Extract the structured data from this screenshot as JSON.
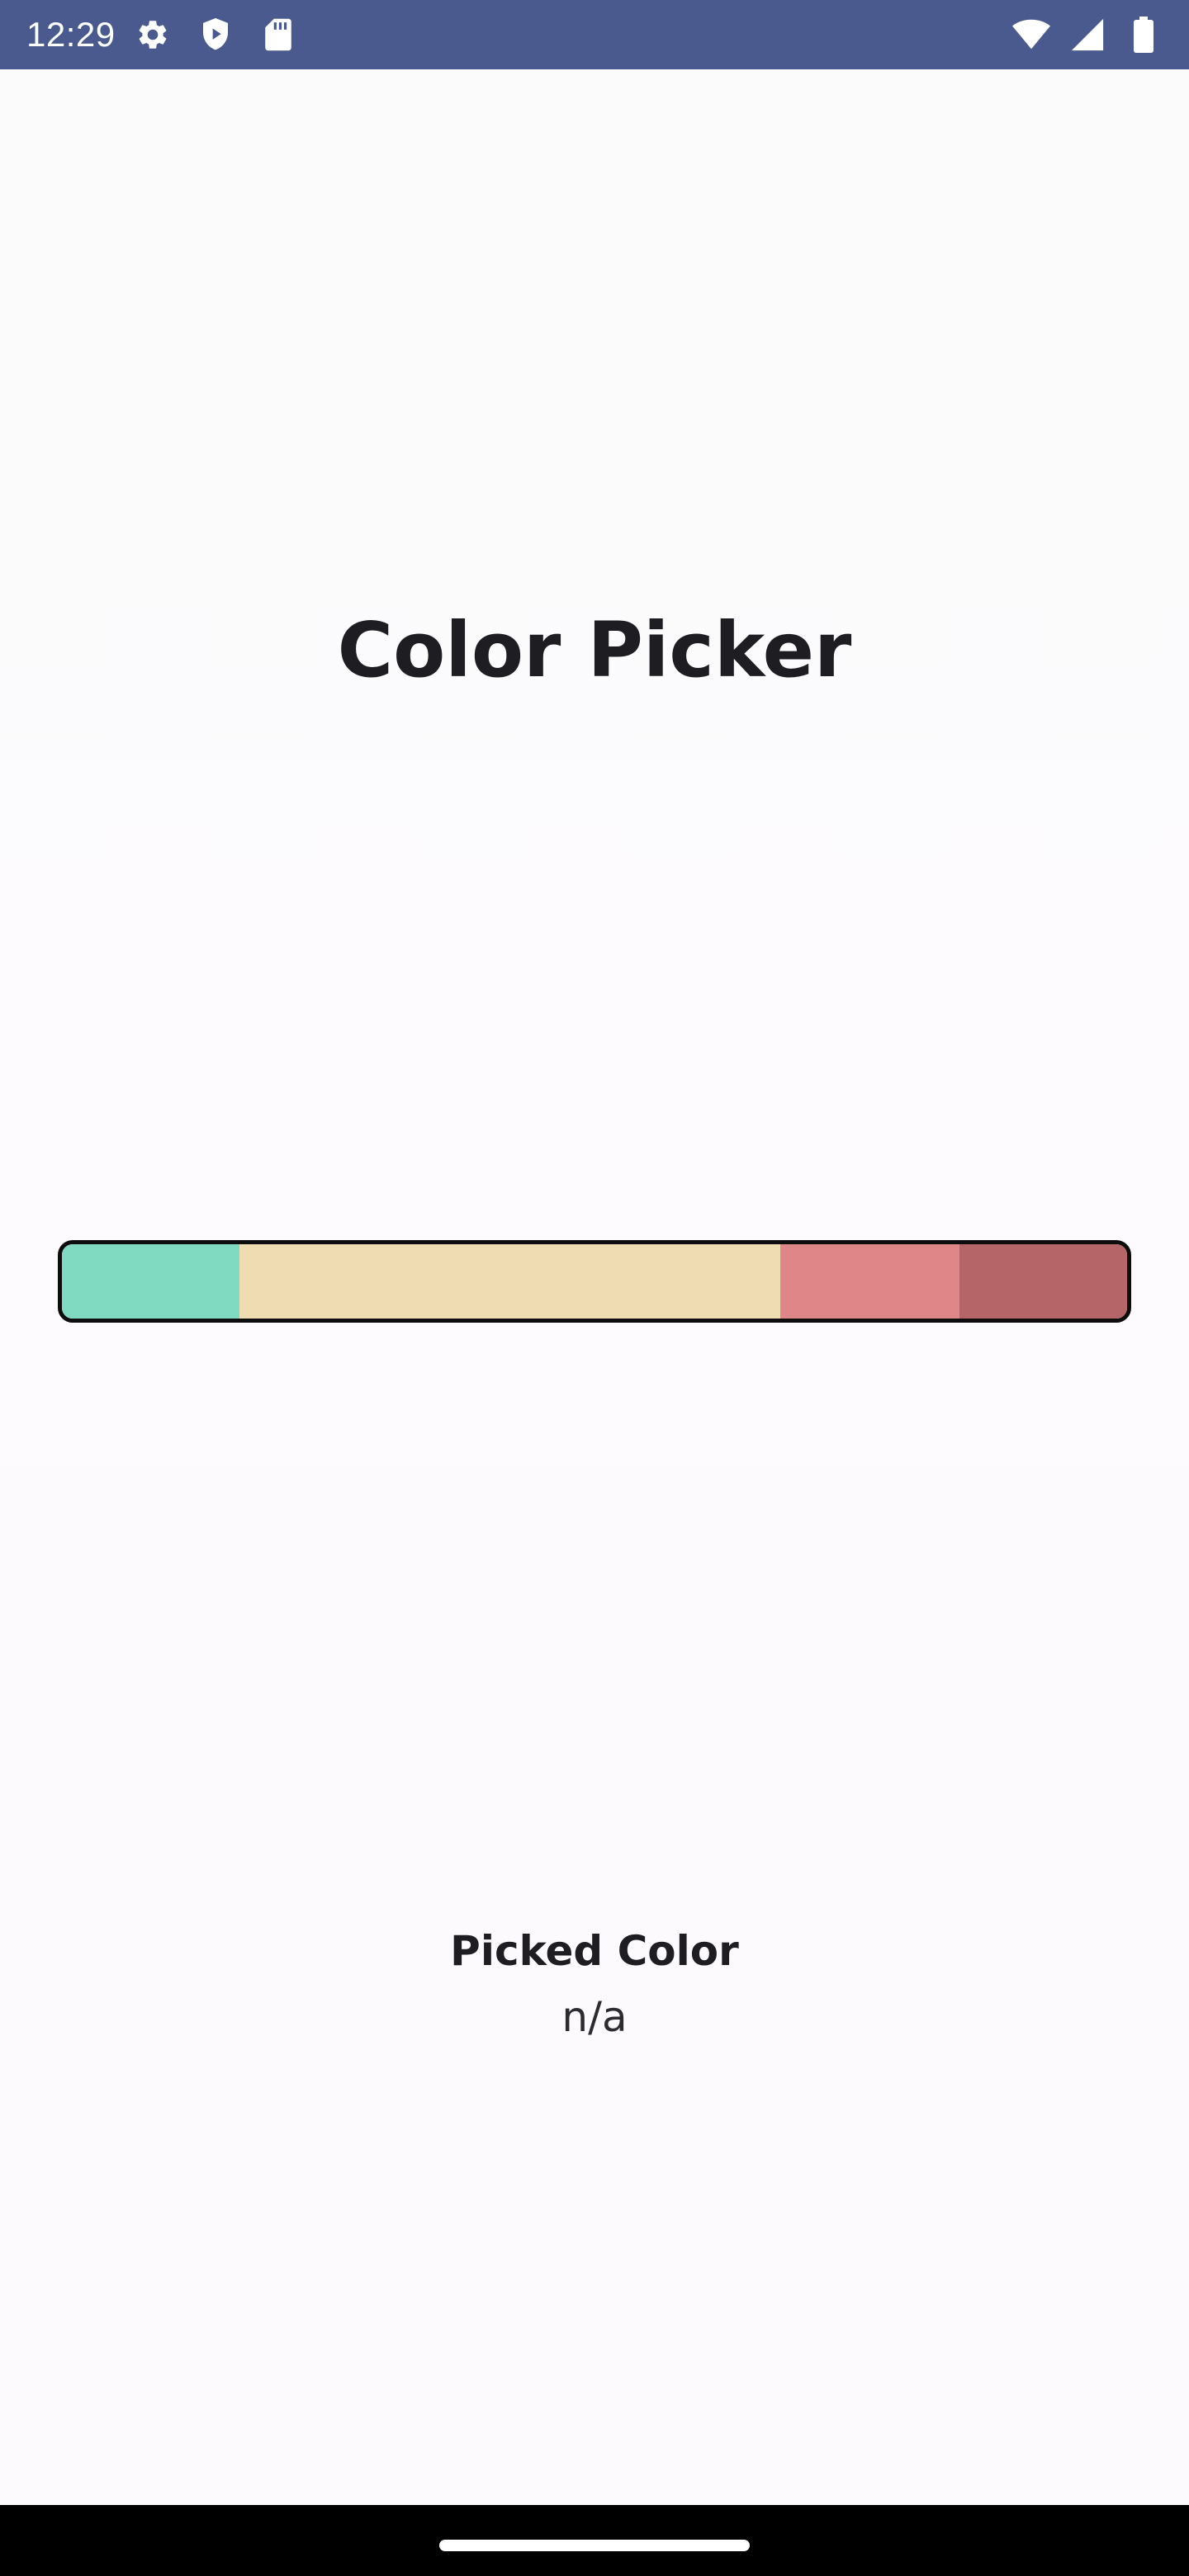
{
  "status_bar": {
    "time": "12:29",
    "left_icons": [
      "gear-icon",
      "shield-play-icon",
      "sd-card-icon"
    ],
    "right_icons": [
      "wifi-icon",
      "signal-icon",
      "battery-icon"
    ]
  },
  "main": {
    "title": "Color Picker",
    "swatches": [
      {
        "name": "teal",
        "color": "#7fdac1"
      },
      {
        "name": "sand",
        "color": "#efdcb2"
      },
      {
        "name": "rose",
        "color": "#de8688"
      },
      {
        "name": "maroon",
        "color": "#b56467"
      }
    ],
    "picked_label": "Picked Color",
    "picked_value": "n/a"
  },
  "colors": {
    "status_bar_bg": "#4a5a8e",
    "background": "#fdfcfd",
    "bar_border": "#0d0d0d"
  }
}
